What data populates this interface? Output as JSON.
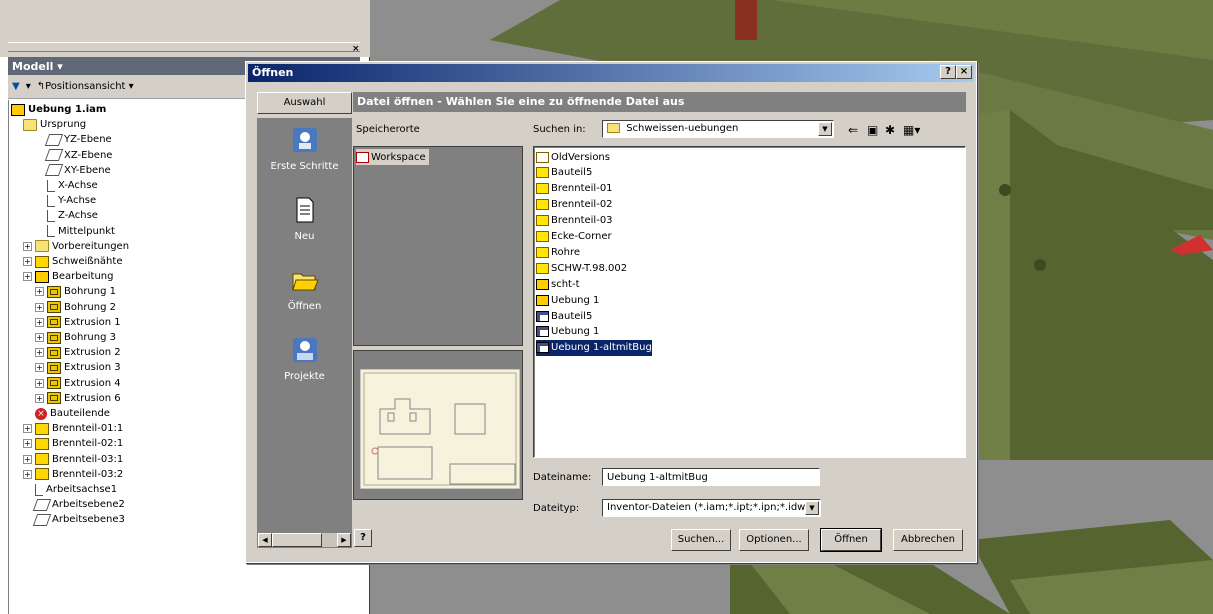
{
  "panel": {
    "title": "Modell ▾",
    "close": "×",
    "tool_view": "Positionsansicht",
    "tree": [
      {
        "label": "Uebung 1.iam",
        "bold": true,
        "icon": "assembly-icon",
        "indent": 0
      },
      {
        "label": "Ursprung",
        "icon": "folder-icon",
        "indent": 1
      },
      {
        "label": "YZ-Ebene",
        "icon": "plane-icon",
        "indent": 2
      },
      {
        "label": "XZ-Ebene",
        "icon": "plane-icon",
        "indent": 2
      },
      {
        "label": "XY-Ebene",
        "icon": "plane-icon",
        "indent": 2
      },
      {
        "label": "X-Achse",
        "icon": "axis-icon",
        "indent": 2
      },
      {
        "label": "Y-Achse",
        "icon": "axis-icon",
        "indent": 2
      },
      {
        "label": "Z-Achse",
        "icon": "axis-icon",
        "indent": 2
      },
      {
        "label": "Mittelpunkt",
        "icon": "point-icon",
        "indent": 2
      },
      {
        "label": "Vorbereitungen",
        "icon": "prep-icon",
        "indent": 1
      },
      {
        "label": "Schweißnähte",
        "icon": "weld-icon",
        "indent": 1
      },
      {
        "label": "Bearbeitung",
        "icon": "machining-icon",
        "indent": 1
      },
      {
        "label": "Bohrung 1",
        "icon": "hole-icon",
        "indent": 2
      },
      {
        "label": "Bohrung 2",
        "icon": "hole-icon",
        "indent": 2
      },
      {
        "label": "Extrusion 1",
        "icon": "extrusion-icon",
        "indent": 2
      },
      {
        "label": "Bohrung 3",
        "icon": "hole-icon",
        "indent": 2
      },
      {
        "label": "Extrusion 2",
        "icon": "extrusion-icon",
        "indent": 2
      },
      {
        "label": "Extrusion 3",
        "icon": "extrusion-icon",
        "indent": 2
      },
      {
        "label": "Extrusion 4",
        "icon": "extrusion-icon",
        "indent": 2
      },
      {
        "label": "Extrusion 6",
        "icon": "extrusion-icon",
        "indent": 2
      },
      {
        "label": "Bauteilende",
        "icon": "end-icon",
        "indent": 1
      },
      {
        "label": "Brennteil-01:1",
        "icon": "part-icon",
        "indent": 1
      },
      {
        "label": "Brennteil-02:1",
        "icon": "part-icon",
        "indent": 1
      },
      {
        "label": "Brennteil-03:1",
        "icon": "part-icon",
        "indent": 1
      },
      {
        "label": "Brennteil-03:2",
        "icon": "part-icon",
        "indent": 1
      },
      {
        "label": "Arbeitsachse1",
        "icon": "axis-icon",
        "indent": 1
      },
      {
        "label": "Arbeitsebene2",
        "icon": "plane-icon",
        "indent": 1
      },
      {
        "label": "Arbeitsebene3",
        "icon": "plane-icon",
        "indent": 1
      }
    ]
  },
  "dialog": {
    "title": "Öffnen",
    "help_btn": "?",
    "close_btn": "×",
    "header": "Datei öffnen - Wählen Sie eine zu öffnende Datei aus",
    "auswahl": "Auswahl",
    "side_items": [
      {
        "label": "Erste Schritte",
        "icon": "getting-started-icon"
      },
      {
        "label": "Neu",
        "icon": "new-file-icon"
      },
      {
        "label": "Öffnen",
        "icon": "open-folder-icon"
      },
      {
        "label": "Projekte",
        "icon": "projects-icon"
      }
    ],
    "locations_label": "Speicherorte",
    "locations": [
      "Workspace"
    ],
    "search_in_label": "Suchen in:",
    "search_in_value": "Schweissen-uebungen",
    "files": [
      {
        "name": "OldVersions",
        "type": "folder"
      },
      {
        "name": "Bauteil5",
        "type": "folder"
      },
      {
        "name": "Brennteil-01",
        "type": "folder"
      },
      {
        "name": "Brennteil-02",
        "type": "folder"
      },
      {
        "name": "Brennteil-03",
        "type": "folder"
      },
      {
        "name": "Ecke-Corner",
        "type": "folder"
      },
      {
        "name": "Rohre",
        "type": "folder"
      },
      {
        "name": "SCHW-T.98.002",
        "type": "folder"
      },
      {
        "name": "scht-t",
        "type": "assembly"
      },
      {
        "name": "Uebung 1",
        "type": "assembly"
      },
      {
        "name": "Bauteil5",
        "type": "drawing"
      },
      {
        "name": "Uebung 1",
        "type": "drawing"
      },
      {
        "name": "Uebung 1-altmitBug",
        "type": "drawing",
        "selected": true
      }
    ],
    "filename_label": "Dateiname:",
    "filename_value": "Uebung 1-altmitBug",
    "filetype_label": "Dateityp:",
    "filetype_value": "Inventor-Dateien (*.iam;*.ipt;*.ipn;*.idw;*.ide)",
    "buttons": {
      "search": "Suchen...",
      "options": "Optionen...",
      "open": "Öffnen",
      "cancel": "Abbrechen"
    },
    "help_icon": "?"
  }
}
